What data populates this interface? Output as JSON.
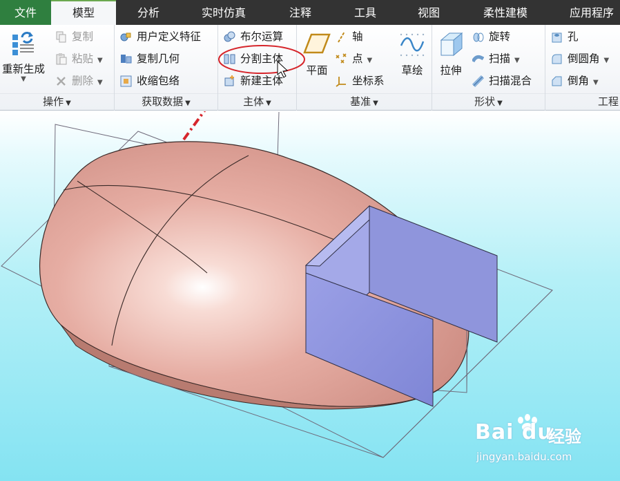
{
  "tabs": [
    "文件",
    "模型",
    "分析",
    "实时仿真",
    "注释",
    "工具",
    "视图",
    "柔性建模",
    "应用程序"
  ],
  "groups": {
    "operations": {
      "label": "操作",
      "regenerate": "重新生成",
      "copy": "复制",
      "paste": "粘贴",
      "delete": "删除"
    },
    "get_data": {
      "label": "获取数据",
      "user_defined_feature": "用户定义特征",
      "copy_geometry": "复制几何",
      "shrinkwrap": "收缩包络"
    },
    "body": {
      "label": "主体",
      "boolean": "布尔运算",
      "split_body": "分割主体",
      "new_body": "新建主体"
    },
    "datum": {
      "label": "基准",
      "plane": "平面",
      "axis": "轴",
      "point": "点",
      "csys": "坐标系",
      "sketch": "草绘"
    },
    "shapes": {
      "label": "形状",
      "extrude": "拉伸",
      "revolve": "旋转",
      "sweep": "扫描",
      "swept_blend": "扫描混合"
    },
    "engineering": {
      "label": "工程",
      "hole": "孔",
      "round": "倒圆角",
      "chamfer": "倒角"
    }
  },
  "watermark": {
    "brand": "Bai du",
    "suffix": "经验",
    "url": "jingyan.baidu.com"
  },
  "colors": {
    "file_tab": "#2f7f3f",
    "tab_bar": "#333333",
    "highlight_ring": "#d6262c",
    "body_fill": "#e9b3a8",
    "plane_fill": "#8d93de"
  }
}
